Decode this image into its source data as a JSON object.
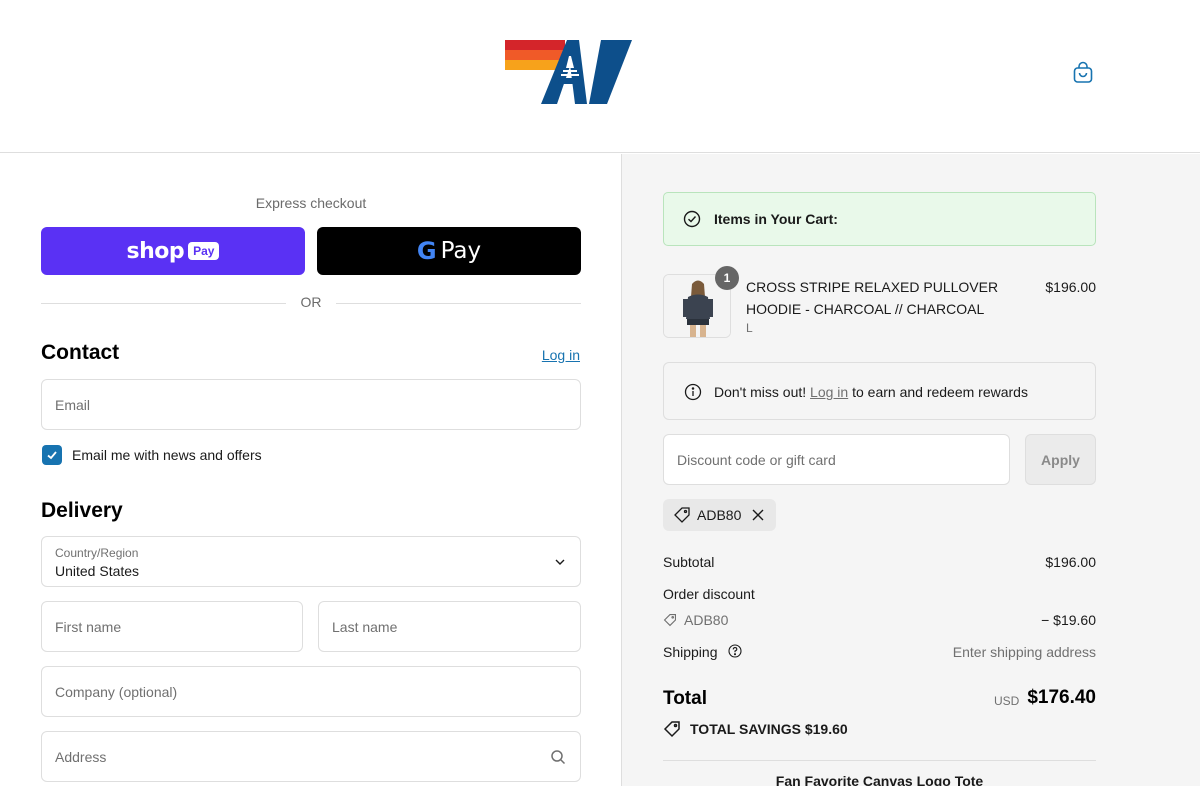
{
  "header": {
    "logo_icon": "av-stripes-logo",
    "cart_icon": "shopping-bag-icon",
    "brand_colors": [
      "#d4252a",
      "#f05a28",
      "#f7a21b",
      "#0d4f8b"
    ]
  },
  "checkout": {
    "express_title": "Express checkout",
    "shop_pay": {
      "word": "shop",
      "pill": "Pay"
    },
    "gpay": {
      "g": "G",
      "word": "Pay"
    },
    "or_text": "OR",
    "contact": {
      "title": "Contact",
      "login_label": "Log in",
      "email_placeholder": "Email",
      "newsletter_label": "Email me with news and offers",
      "newsletter_checked": true
    },
    "delivery": {
      "title": "Delivery",
      "country_label": "Country/Region",
      "country_value": "United States",
      "first_name_placeholder": "First name",
      "last_name_placeholder": "Last name",
      "company_placeholder": "Company (optional)",
      "address_placeholder": "Address"
    }
  },
  "summary": {
    "banner_text": "Items in Your Cart:",
    "item": {
      "quantity": "1",
      "name": "CROSS STRIPE RELAXED PULLOVER HOODIE - CHARCOAL // CHARCOAL",
      "variant": "L",
      "price": "$196.00"
    },
    "rewards": {
      "prefix": "Don't miss out! ",
      "link": "Log in",
      "suffix": " to earn and redeem rewards"
    },
    "discount_placeholder": "Discount code or gift card",
    "apply_label": "Apply",
    "applied_code": "ADB80",
    "subtotal_label": "Subtotal",
    "subtotal_value": "$196.00",
    "order_discount_label": "Order discount",
    "order_discount_code": "ADB80",
    "order_discount_value": "− $19.60",
    "shipping_label": "Shipping",
    "shipping_value": "Enter shipping address",
    "total_label": "Total",
    "total_currency": "USD",
    "total_value": "$176.40",
    "savings_label": "TOTAL SAVINGS  $19.60",
    "promo_text": "Fan Favorite Canvas Logo Tote"
  }
}
